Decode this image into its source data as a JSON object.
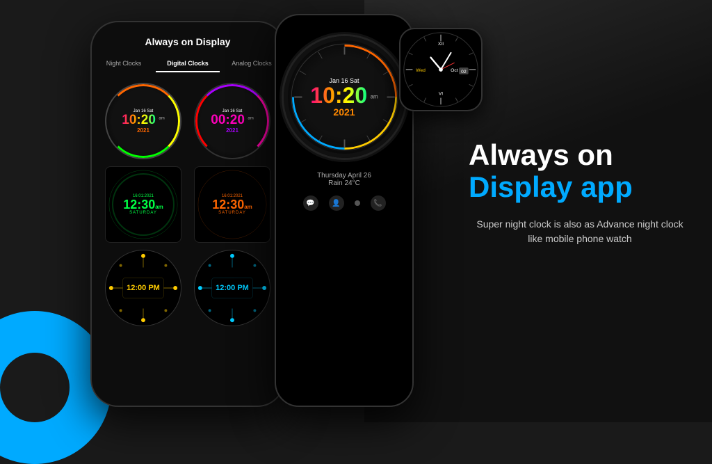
{
  "background": {
    "color": "#1a1a1a"
  },
  "phone1": {
    "title": "Always on Display",
    "tabs": [
      {
        "label": "Night Clocks",
        "active": false
      },
      {
        "label": "Digital Clocks",
        "active": true
      },
      {
        "label": "Analog Clocks",
        "active": false
      }
    ],
    "clocks": [
      {
        "id": "clock1",
        "type": "analog-digital",
        "date": "Jan 16 Sat",
        "time": "10:20",
        "ampm": "am",
        "year": "2021",
        "color": "rainbow"
      },
      {
        "id": "clock2",
        "type": "analog-digital",
        "date": "Jan 16 Sat",
        "time": "00:20",
        "ampm": "am",
        "year": "2021",
        "color": "pink-purple"
      },
      {
        "id": "clock3",
        "type": "rect-digital",
        "date": "16:01 2021",
        "time": "12:30am",
        "day": "SATURDAY",
        "color": "green"
      },
      {
        "id": "clock4",
        "type": "rect-digital",
        "date": "16:01 2021",
        "time": "12:30am",
        "day": "SATURDAY",
        "color": "orange"
      },
      {
        "id": "clock5",
        "type": "dot-circle",
        "time": "12:00 PM",
        "color": "yellow"
      },
      {
        "id": "clock6",
        "type": "dot-circle",
        "time": "12:00 PM",
        "color": "cyan"
      }
    ]
  },
  "phone2": {
    "date": "Jan 16 Sat",
    "time": "10:20",
    "ampm": "am",
    "year": "2021",
    "weather": "Thursday April 26",
    "rain": "Rain 24°C"
  },
  "watch": {
    "day": "Wed",
    "date": "02",
    "month": "Oct"
  },
  "rightContent": {
    "title_line1": "Always on",
    "title_line2": "Display app",
    "description": "Super night clock is also as Advance night clock like mobile phone watch"
  }
}
